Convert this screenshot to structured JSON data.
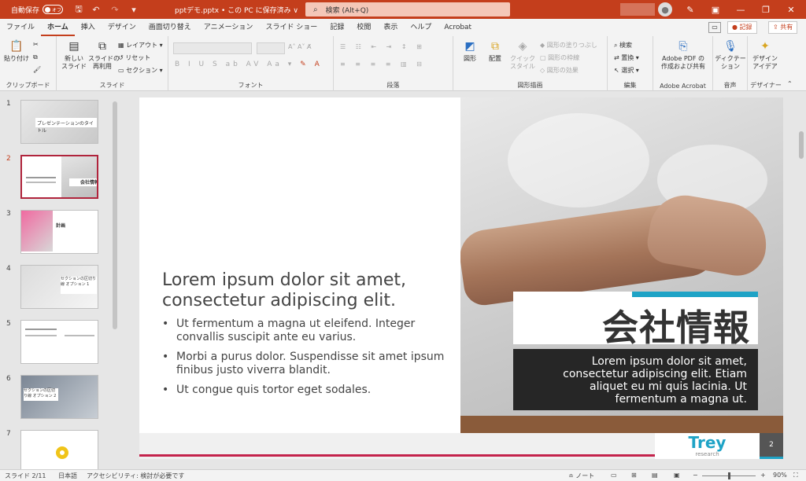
{
  "titlebar": {
    "autosave_label": "自動保存",
    "autosave_state": "オフ",
    "doc_title": "pptデモ.pptx • この PC に保存済み ∨",
    "search_placeholder": "検索 (Alt+Q)"
  },
  "tabs": [
    "ファイル",
    "ホーム",
    "挿入",
    "デザイン",
    "画面切り替え",
    "アニメーション",
    "スライド ショー",
    "記録",
    "校閲",
    "表示",
    "ヘルプ",
    "Acrobat"
  ],
  "tab_actions": {
    "record": "● 記録",
    "share": "⇪ 共有"
  },
  "ribbon": {
    "clipboard": {
      "paste": "貼り付け",
      "label": "クリップボード"
    },
    "slides": {
      "new_slide": "新しい\nスライド",
      "reuse": "スライドの\n再利用",
      "layout": "レイアウト",
      "reset": "リセット",
      "section": "セクション",
      "label": "スライド"
    },
    "font": {
      "label": "フォント"
    },
    "paragraph": {
      "label": "段落"
    },
    "drawing": {
      "shapes": "図形",
      "arrange": "配置",
      "quick_styles": "クイック\nスタイル",
      "fill": "図形の塗りつぶし",
      "outline": "図形の枠線",
      "effects": "図形の効果",
      "label": "図形描画"
    },
    "editing": {
      "find": "検索",
      "replace": "置換",
      "select": "選択",
      "label": "編集"
    },
    "acrobat": {
      "create": "Adobe PDF の\n作成および共有",
      "label": "Adobe Acrobat"
    },
    "voice": {
      "dictate": "ディクテー\nション",
      "label": "音声"
    },
    "designer": {
      "ideas": "デザイン\nアイデア",
      "label": "デザイナー"
    }
  },
  "thumbnails": [
    {
      "num": "1",
      "caption": "プレゼンテーションのタイトル"
    },
    {
      "num": "2",
      "caption": "会社情報"
    },
    {
      "num": "3",
      "caption": "計画"
    },
    {
      "num": "4",
      "caption": "セクションの区切り線 オプション 1"
    },
    {
      "num": "5",
      "caption": ""
    },
    {
      "num": "6",
      "caption": "セクションの区切り線 オプション 2"
    },
    {
      "num": "7",
      "caption": ""
    }
  ],
  "slide": {
    "heading": "Lorem ipsum dolor sit amet, consectetur adipiscing elit.",
    "bullets": [
      "Ut fermentum a magna ut eleifend. Integer convallis suscipit ante eu varius.",
      "Morbi a purus dolor. Suspendisse sit amet ipsum finibus justo viverra blandit.",
      "Ut congue quis tortor eget sodales."
    ],
    "card_title": "会社情報",
    "card_body": "Lorem ipsum dolor sit amet, consectetur adipiscing elit. Etiam aliquet eu mi quis lacinia. Ut fermentum a magna ut.",
    "logo_main": "Trey",
    "logo_sub": "research",
    "slide_number": "2"
  },
  "status": {
    "slide_info": "スライド 2/11",
    "language": "日本語",
    "accessibility": "アクセシビリティ: 検討が必要です",
    "notes": "≐ ノート",
    "zoom": "90%"
  },
  "colors": {
    "brand": "#c43e1c",
    "accent_cyan": "#1ea3c6",
    "accent_pink": "#c4234c"
  }
}
